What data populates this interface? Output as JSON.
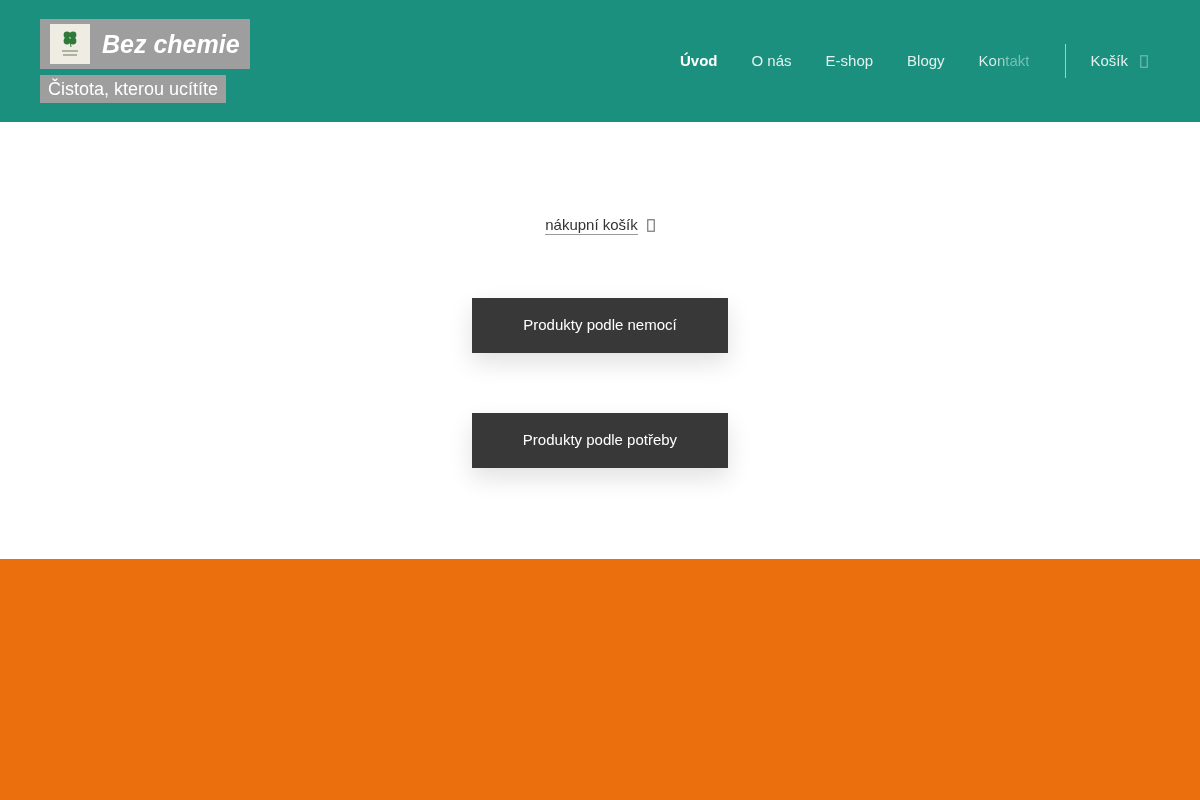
{
  "header": {
    "site_title": "Bez chemie",
    "tagline": "Čistota, kterou ucítíte",
    "nav": [
      {
        "label": "Úvod",
        "selected": true,
        "fading": false
      },
      {
        "label": "O nás",
        "selected": false,
        "fading": false
      },
      {
        "label": "E-shop",
        "selected": false,
        "fading": false
      },
      {
        "label": "Blogy",
        "selected": false,
        "fading": false
      },
      {
        "label": "Kontakt",
        "selected": false,
        "fading": true
      }
    ],
    "cart": {
      "label": "Košík"
    }
  },
  "main": {
    "cart_link": "nákupní košík",
    "buttons": [
      "Produkty podle nemocí",
      "Produkty podle potřeby"
    ]
  }
}
